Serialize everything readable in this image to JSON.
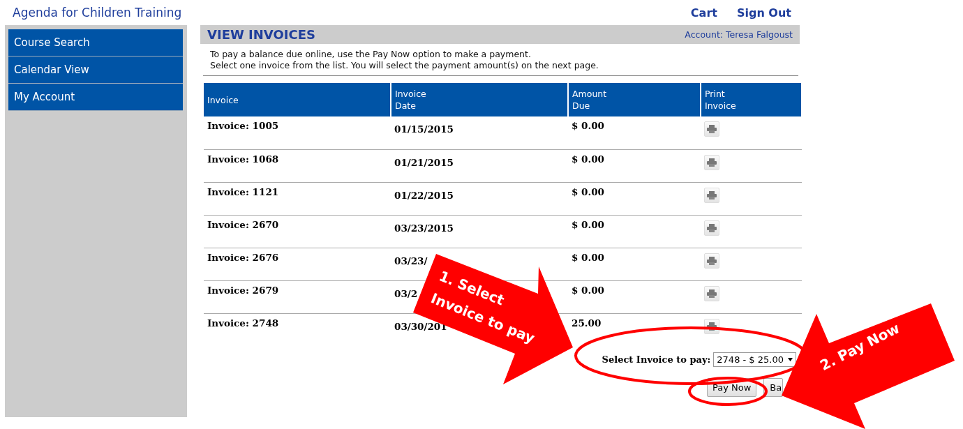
{
  "site_title": "Agenda for Children Training",
  "top_links": [
    "Cart",
    "Sign Out"
  ],
  "sidebar": {
    "items": [
      {
        "label": "Course Search"
      },
      {
        "label": "Calendar View"
      },
      {
        "label": "My Account"
      }
    ]
  },
  "page": {
    "title": "VIEW INVOICES",
    "account": "Account: Teresa Falgoust",
    "instructions": [
      "To pay a balance due online, use the Pay Now option to make a payment.",
      "Select one invoice from the list. You will select the payment amount(s) on the next page."
    ]
  },
  "table": {
    "columns": [
      "Invoice",
      "Invoice Date",
      "Amount Due",
      "Print Invoice"
    ],
    "rows": [
      {
        "invoice": "Invoice: 1005",
        "date": "01/15/2015",
        "amount": "$ 0.00"
      },
      {
        "invoice": "Invoice: 1068",
        "date": "01/21/2015",
        "amount": "$ 0.00"
      },
      {
        "invoice": "Invoice: 1121",
        "date": "01/22/2015",
        "amount": "$ 0.00"
      },
      {
        "invoice": "Invoice: 2670",
        "date": "03/23/2015",
        "amount": "$ 0.00"
      },
      {
        "invoice": "Invoice: 2676",
        "date": "03/23/",
        "amount": "$ 0.00"
      },
      {
        "invoice": "Invoice: 2679",
        "date": "03/2",
        "amount": "$ 0.00"
      },
      {
        "invoice": "Invoice: 2748",
        "date": "03/30/201",
        "amount": "25.00"
      }
    ]
  },
  "payment": {
    "label": "Select Invoice to pay:",
    "value": "2748 - $ 25.00"
  },
  "buttons": [
    "Pay Now",
    "Ba"
  ],
  "annotations": [
    {
      "lines": [
        "1. Select",
        "Invoice to pay"
      ]
    },
    {
      "lines": [
        "2. Pay Now"
      ]
    }
  ]
}
